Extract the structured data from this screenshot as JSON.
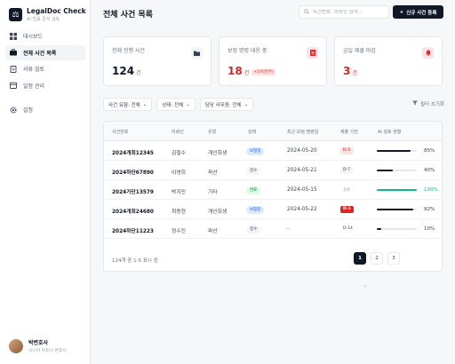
{
  "brand": {
    "title": "LegalDoc Check",
    "subtitle": "AI 법률 문서 검토"
  },
  "sidebar": {
    "items": [
      {
        "label": "대시보드",
        "icon": "dashboard-icon"
      },
      {
        "label": "전체 사건 목록",
        "icon": "briefcase-icon",
        "active": true
      },
      {
        "label": "서류 검토",
        "icon": "document-icon"
      },
      {
        "label": "일정 관리",
        "icon": "calendar-icon"
      }
    ],
    "settings": {
      "label": "설정",
      "icon": "gear-icon"
    }
  },
  "user": {
    "name": "박변호사",
    "role": "시니어 파트너 변호사"
  },
  "header": {
    "title": "전체 사건 목록",
    "search_placeholder": "사건번호, 의뢰인 검색...",
    "new_button": "신규 사건 등록"
  },
  "stats": [
    {
      "label": "전체 진행 사건",
      "value": "124",
      "unit": "건",
      "icon": "folder-icon"
    },
    {
      "label": "보정 명령 대응 중",
      "value": "18",
      "unit": "건",
      "delta": "+2(이번주)",
      "icon": "document-alert-icon"
    },
    {
      "label": "금일 제출 마감",
      "value": "3",
      "unit": "건",
      "icon": "bell-icon"
    }
  ],
  "filters": [
    {
      "label": "사건 유형: 전체"
    },
    {
      "label": "상태: 전체"
    },
    {
      "label": "담당 사무원: 전체"
    }
  ],
  "reset_label": "필터 초기화",
  "table": {
    "columns": [
      "사건번호",
      "의뢰인",
      "유형",
      "상태",
      "최근 보정 명령일",
      "제출 기한",
      "AI 검토 현황"
    ],
    "rows": [
      {
        "case": "2024개회12345",
        "client": "김철수",
        "type": "개인회생",
        "status": "보정중",
        "date": "2024-05-20",
        "deadline": "D-3",
        "progress": 0.85,
        "pct": "85%"
      },
      {
        "case": "2024하단67890",
        "client": "이영희",
        "type": "파산",
        "status": "접수",
        "date": "2024-05-21",
        "deadline": "D-7",
        "progress": 0.4,
        "pct": "40%"
      },
      {
        "case": "2024가단13579",
        "client": "박지민",
        "type": "기타",
        "status": "완료",
        "date": "2024-05-15",
        "deadline": "종료",
        "progress": 1.0,
        "pct": "100%"
      },
      {
        "case": "2024개회24680",
        "client": "최동현",
        "type": "개인회생",
        "status": "보정중",
        "date": "2024-05-22",
        "deadline": "D-1",
        "progress": 0.92,
        "pct": "92%"
      },
      {
        "case": "2024하단11223",
        "client": "정수진",
        "type": "파산",
        "status": "접수",
        "date": "-",
        "deadline": "D-14",
        "progress": 0.1,
        "pct": "10%"
      }
    ]
  },
  "pagination": {
    "info": "124개 중 1-5 표시 중",
    "pages": [
      "1",
      "2",
      "3"
    ],
    "prev": "‹",
    "next": "›"
  },
  "colors": {
    "primary": "#111827",
    "danger": "#dc2626",
    "success": "#10b981"
  }
}
